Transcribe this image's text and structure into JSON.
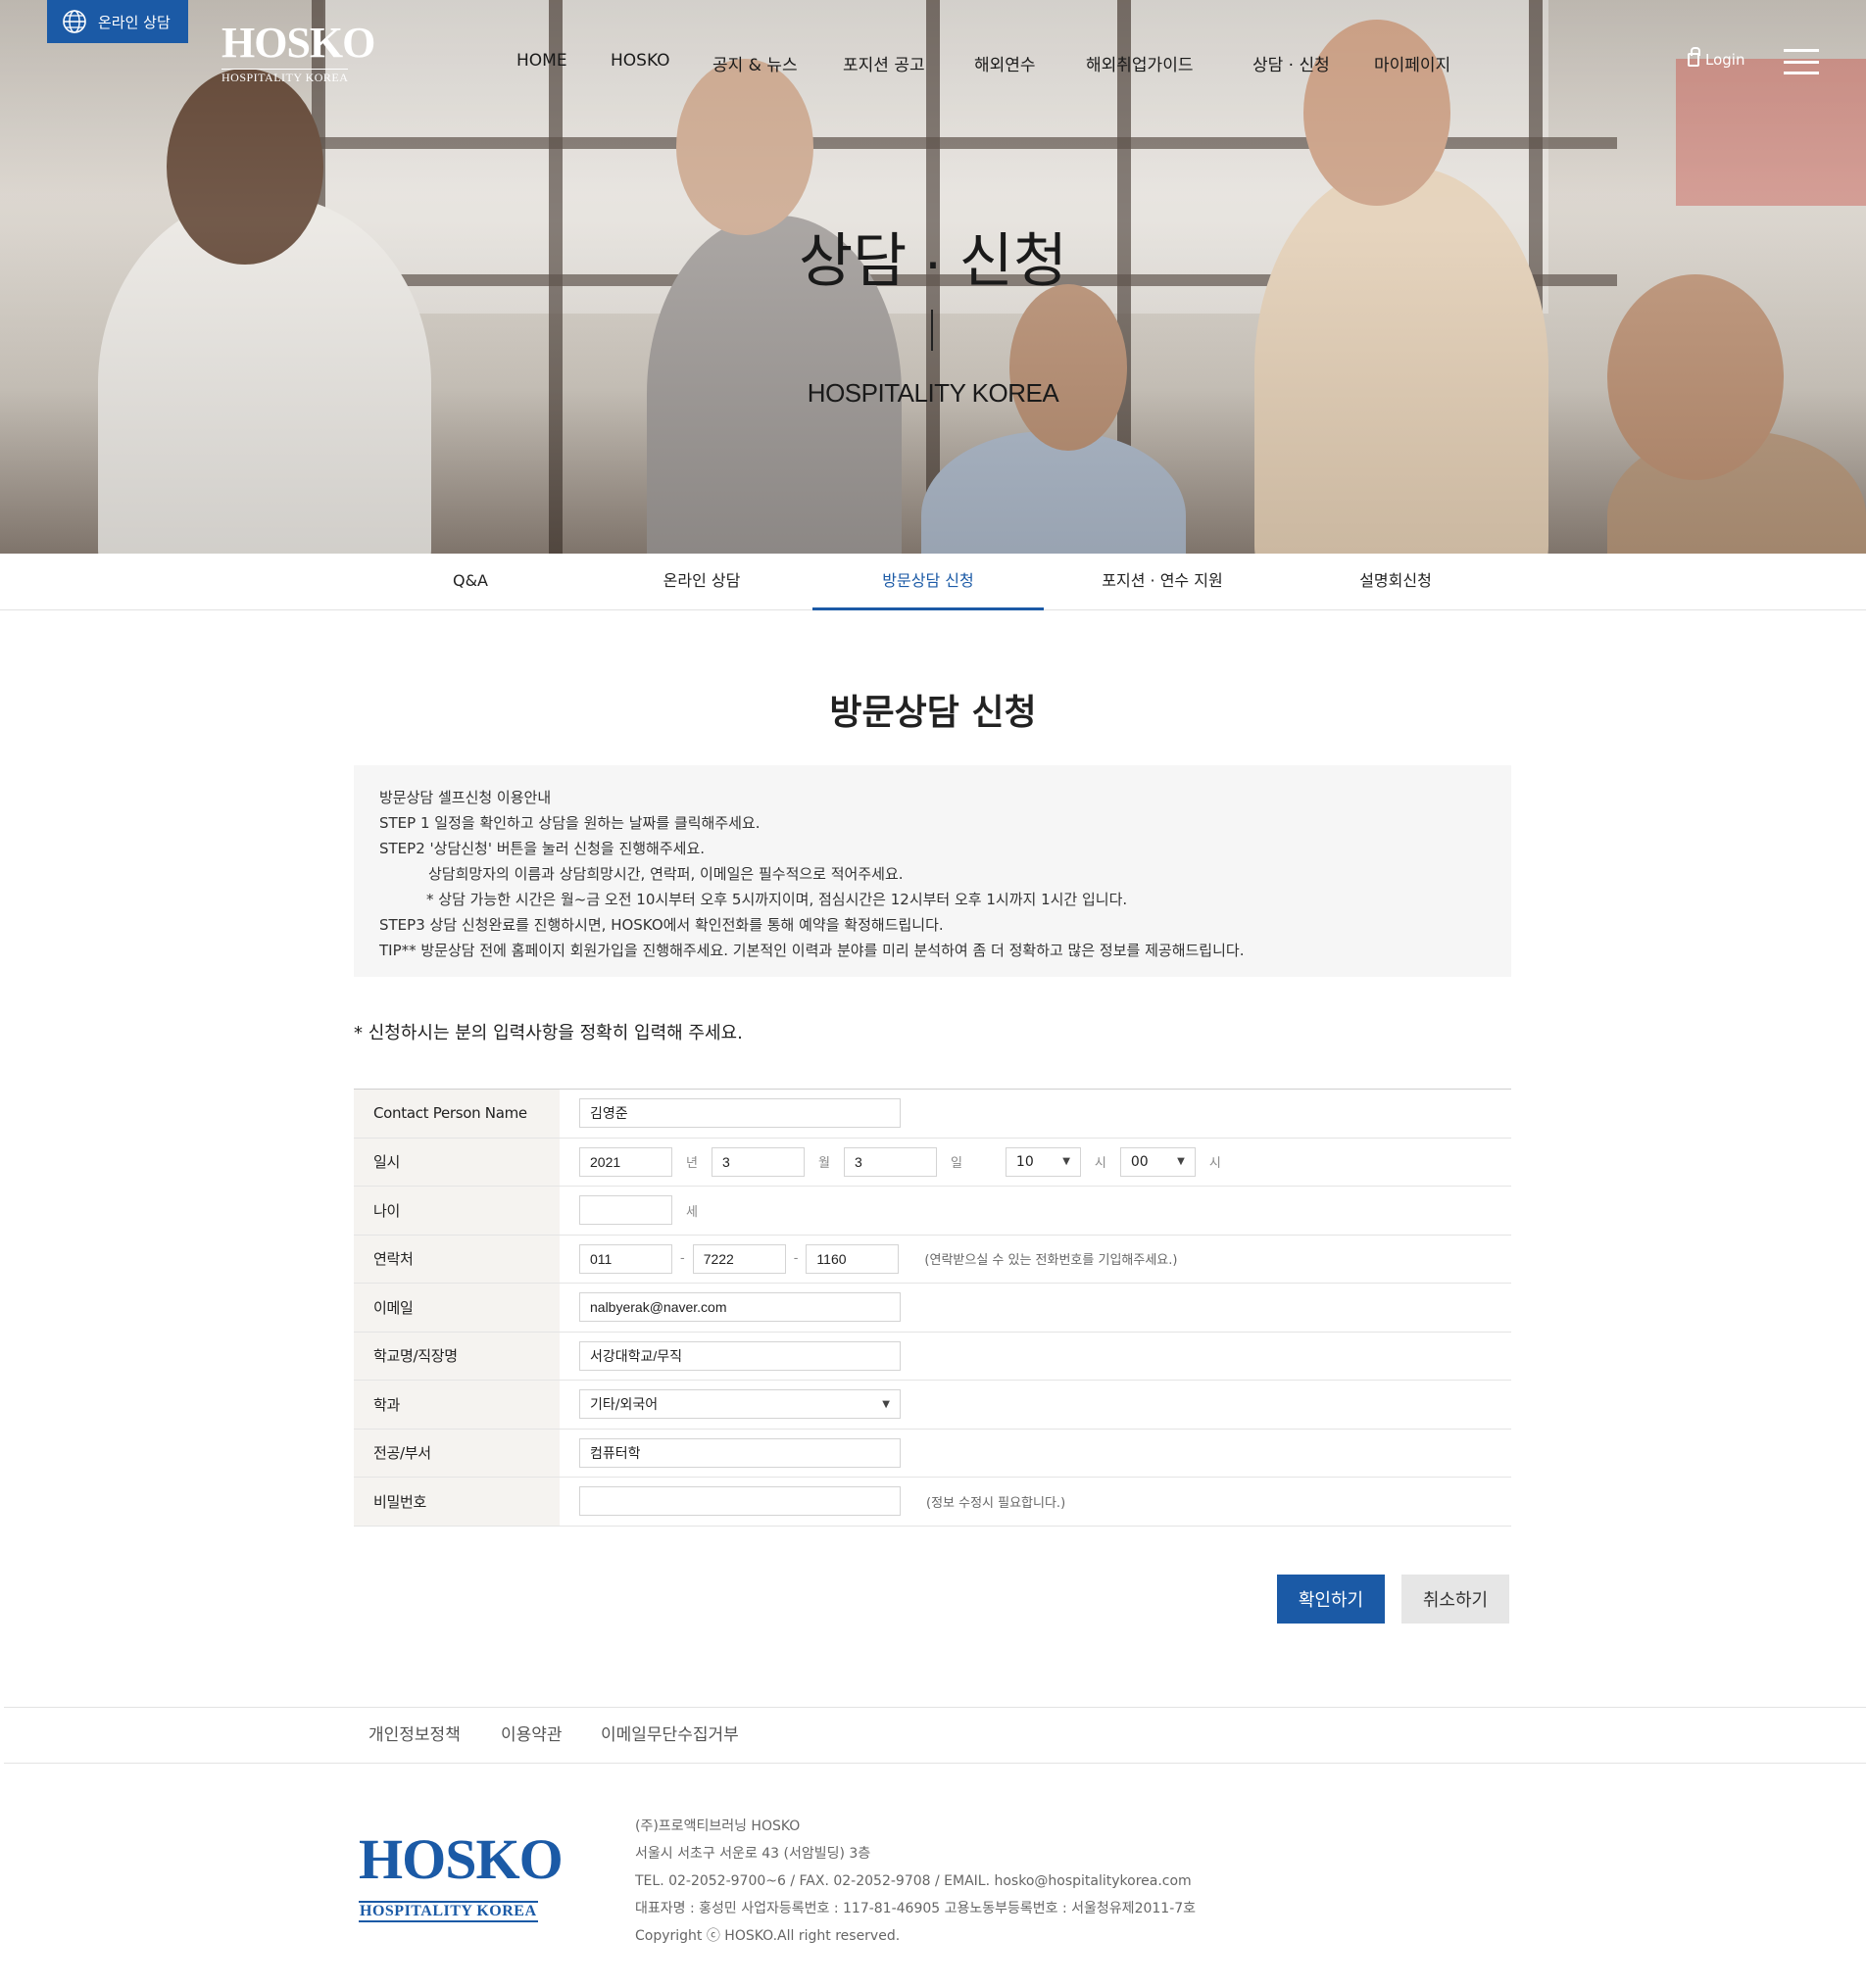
{
  "header": {
    "online_badge": "온라인 상담",
    "logo_main": "HOSKO",
    "logo_sub": "HOSPITALITY KOREA",
    "nav": [
      "HOME",
      "HOSKO",
      "공지 & 뉴스",
      "포지션 공고",
      "해외연수",
      "해외취업가이드",
      "상담 · 신청",
      "마이페이지"
    ],
    "login": "Login"
  },
  "hero": {
    "title": "상담 · 신청",
    "subtitle": "HOSPITALITY KOREA"
  },
  "subnav": {
    "tabs": [
      "Q&A",
      "온라인 상담",
      "방문상담 신청",
      "포지션 · 연수 지원",
      "설명회신청"
    ],
    "active_index": 2
  },
  "page": {
    "title": "방문상담 신청",
    "guide": [
      "방문상담 셀프신청 이용안내",
      "STEP 1 일정을 확인하고 상담을 원하는 날짜를 클릭해주세요.",
      "STEP2 '상담신청' 버튼을 눌러 신청을 진행해주세요.",
      "상담희망자의 이름과 상담희망시간, 연락퍼, 이메일은 필수적으로 적어주세요.",
      "* 상담 가능한 시간은 월~금 오전 10시부터 오후 5시까지이며, 점심시간은 12시부터 오후 1시까지 1시간 입니다.",
      "STEP3 상담 신청완료를 진행하시면, HOSKO에서 확인전화를 통해 예약을 확정해드립니다.",
      "TIP** 방문상담 전에 홈페이지 회원가입을 진행해주세요. 기본적인 이력과 분야를 미리 분석하여 좀 더 정확하고 많은 정보를 제공해드립니다."
    ],
    "notice": "* 신청하시는 분의 입력사항을 정확히 입력해 주세요."
  },
  "form": {
    "name": {
      "label": "Contact Person Name",
      "value": "김영준"
    },
    "datetime": {
      "label": "일시",
      "year": "2021",
      "year_unit": "년",
      "month": "3",
      "month_unit": "월",
      "day": "3",
      "day_unit": "일",
      "hour": "10",
      "hour_unit": "시",
      "minute": "00",
      "minute_unit": "시"
    },
    "age": {
      "label": "나이",
      "value": "",
      "unit": "세"
    },
    "phone": {
      "label": "연락처",
      "p1": "011",
      "p2": "7222",
      "p3": "1160",
      "sep": "-",
      "hint": "(연락받으실 수 있는 전화번호를 기입해주세요.)"
    },
    "email": {
      "label": "이메일",
      "value": "nalbyerak@naver.com"
    },
    "school": {
      "label": "학교명/직장명",
      "value": "서강대학교/무직"
    },
    "dept": {
      "label": "학과",
      "value": "기타/외국어"
    },
    "major": {
      "label": "전공/부서",
      "value": "컴퓨터학"
    },
    "password": {
      "label": "비밀번호",
      "value": "",
      "hint": "(정보 수정시 필요합니다.)"
    }
  },
  "buttons": {
    "confirm": "확인하기",
    "cancel": "취소하기"
  },
  "footer": {
    "links": [
      "개인정보정책",
      "이용약관",
      "이메일무단수집거부"
    ],
    "logo_main": "HOSKO",
    "logo_sub": "HOSPITALITY KOREA",
    "info": [
      "(주)프로액티브러닝 HOSKO",
      "서울시 서초구 서운로 43 (서암빌딩) 3층",
      "TEL. 02-2052-9700~6 / FAX. 02-2052-9708 / EMAIL. hosko@hospitalitykorea.com",
      "대표자명 : 홍성민 사업자등록번호 : 117-81-46905 고용노동부등록번호 : 서울청유제2011-7호",
      "Copyright ⓒ HOSKO.All right reserved."
    ]
  },
  "colors": {
    "accent": "#1b5aa6",
    "label_bg": "#f5f3f0",
    "guide_bg": "#f6f6f6"
  }
}
